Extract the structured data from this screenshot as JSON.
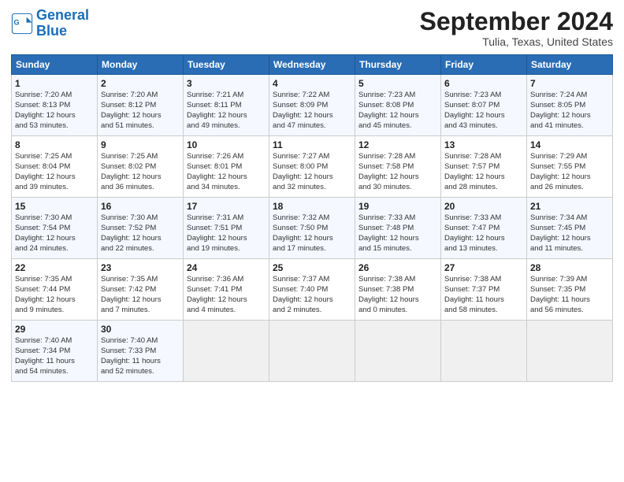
{
  "header": {
    "logo_line1": "General",
    "logo_line2": "Blue",
    "month_title": "September 2024",
    "location": "Tulia, Texas, United States"
  },
  "columns": [
    "Sunday",
    "Monday",
    "Tuesday",
    "Wednesday",
    "Thursday",
    "Friday",
    "Saturday"
  ],
  "rows": [
    [
      {
        "day": "1",
        "lines": [
          "Sunrise: 7:20 AM",
          "Sunset: 8:13 PM",
          "Daylight: 12 hours",
          "and 53 minutes."
        ]
      },
      {
        "day": "2",
        "lines": [
          "Sunrise: 7:20 AM",
          "Sunset: 8:12 PM",
          "Daylight: 12 hours",
          "and 51 minutes."
        ]
      },
      {
        "day": "3",
        "lines": [
          "Sunrise: 7:21 AM",
          "Sunset: 8:11 PM",
          "Daylight: 12 hours",
          "and 49 minutes."
        ]
      },
      {
        "day": "4",
        "lines": [
          "Sunrise: 7:22 AM",
          "Sunset: 8:09 PM",
          "Daylight: 12 hours",
          "and 47 minutes."
        ]
      },
      {
        "day": "5",
        "lines": [
          "Sunrise: 7:23 AM",
          "Sunset: 8:08 PM",
          "Daylight: 12 hours",
          "and 45 minutes."
        ]
      },
      {
        "day": "6",
        "lines": [
          "Sunrise: 7:23 AM",
          "Sunset: 8:07 PM",
          "Daylight: 12 hours",
          "and 43 minutes."
        ]
      },
      {
        "day": "7",
        "lines": [
          "Sunrise: 7:24 AM",
          "Sunset: 8:05 PM",
          "Daylight: 12 hours",
          "and 41 minutes."
        ]
      }
    ],
    [
      {
        "day": "8",
        "lines": [
          "Sunrise: 7:25 AM",
          "Sunset: 8:04 PM",
          "Daylight: 12 hours",
          "and 39 minutes."
        ]
      },
      {
        "day": "9",
        "lines": [
          "Sunrise: 7:25 AM",
          "Sunset: 8:02 PM",
          "Daylight: 12 hours",
          "and 36 minutes."
        ]
      },
      {
        "day": "10",
        "lines": [
          "Sunrise: 7:26 AM",
          "Sunset: 8:01 PM",
          "Daylight: 12 hours",
          "and 34 minutes."
        ]
      },
      {
        "day": "11",
        "lines": [
          "Sunrise: 7:27 AM",
          "Sunset: 8:00 PM",
          "Daylight: 12 hours",
          "and 32 minutes."
        ]
      },
      {
        "day": "12",
        "lines": [
          "Sunrise: 7:28 AM",
          "Sunset: 7:58 PM",
          "Daylight: 12 hours",
          "and 30 minutes."
        ]
      },
      {
        "day": "13",
        "lines": [
          "Sunrise: 7:28 AM",
          "Sunset: 7:57 PM",
          "Daylight: 12 hours",
          "and 28 minutes."
        ]
      },
      {
        "day": "14",
        "lines": [
          "Sunrise: 7:29 AM",
          "Sunset: 7:55 PM",
          "Daylight: 12 hours",
          "and 26 minutes."
        ]
      }
    ],
    [
      {
        "day": "15",
        "lines": [
          "Sunrise: 7:30 AM",
          "Sunset: 7:54 PM",
          "Daylight: 12 hours",
          "and 24 minutes."
        ]
      },
      {
        "day": "16",
        "lines": [
          "Sunrise: 7:30 AM",
          "Sunset: 7:52 PM",
          "Daylight: 12 hours",
          "and 22 minutes."
        ]
      },
      {
        "day": "17",
        "lines": [
          "Sunrise: 7:31 AM",
          "Sunset: 7:51 PM",
          "Daylight: 12 hours",
          "and 19 minutes."
        ]
      },
      {
        "day": "18",
        "lines": [
          "Sunrise: 7:32 AM",
          "Sunset: 7:50 PM",
          "Daylight: 12 hours",
          "and 17 minutes."
        ]
      },
      {
        "day": "19",
        "lines": [
          "Sunrise: 7:33 AM",
          "Sunset: 7:48 PM",
          "Daylight: 12 hours",
          "and 15 minutes."
        ]
      },
      {
        "day": "20",
        "lines": [
          "Sunrise: 7:33 AM",
          "Sunset: 7:47 PM",
          "Daylight: 12 hours",
          "and 13 minutes."
        ]
      },
      {
        "day": "21",
        "lines": [
          "Sunrise: 7:34 AM",
          "Sunset: 7:45 PM",
          "Daylight: 12 hours",
          "and 11 minutes."
        ]
      }
    ],
    [
      {
        "day": "22",
        "lines": [
          "Sunrise: 7:35 AM",
          "Sunset: 7:44 PM",
          "Daylight: 12 hours",
          "and 9 minutes."
        ]
      },
      {
        "day": "23",
        "lines": [
          "Sunrise: 7:35 AM",
          "Sunset: 7:42 PM",
          "Daylight: 12 hours",
          "and 7 minutes."
        ]
      },
      {
        "day": "24",
        "lines": [
          "Sunrise: 7:36 AM",
          "Sunset: 7:41 PM",
          "Daylight: 12 hours",
          "and 4 minutes."
        ]
      },
      {
        "day": "25",
        "lines": [
          "Sunrise: 7:37 AM",
          "Sunset: 7:40 PM",
          "Daylight: 12 hours",
          "and 2 minutes."
        ]
      },
      {
        "day": "26",
        "lines": [
          "Sunrise: 7:38 AM",
          "Sunset: 7:38 PM",
          "Daylight: 12 hours",
          "and 0 minutes."
        ]
      },
      {
        "day": "27",
        "lines": [
          "Sunrise: 7:38 AM",
          "Sunset: 7:37 PM",
          "Daylight: 11 hours",
          "and 58 minutes."
        ]
      },
      {
        "day": "28",
        "lines": [
          "Sunrise: 7:39 AM",
          "Sunset: 7:35 PM",
          "Daylight: 11 hours",
          "and 56 minutes."
        ]
      }
    ],
    [
      {
        "day": "29",
        "lines": [
          "Sunrise: 7:40 AM",
          "Sunset: 7:34 PM",
          "Daylight: 11 hours",
          "and 54 minutes."
        ]
      },
      {
        "day": "30",
        "lines": [
          "Sunrise: 7:40 AM",
          "Sunset: 7:33 PM",
          "Daylight: 11 hours",
          "and 52 minutes."
        ]
      },
      {
        "day": "",
        "lines": []
      },
      {
        "day": "",
        "lines": []
      },
      {
        "day": "",
        "lines": []
      },
      {
        "day": "",
        "lines": []
      },
      {
        "day": "",
        "lines": []
      }
    ]
  ]
}
